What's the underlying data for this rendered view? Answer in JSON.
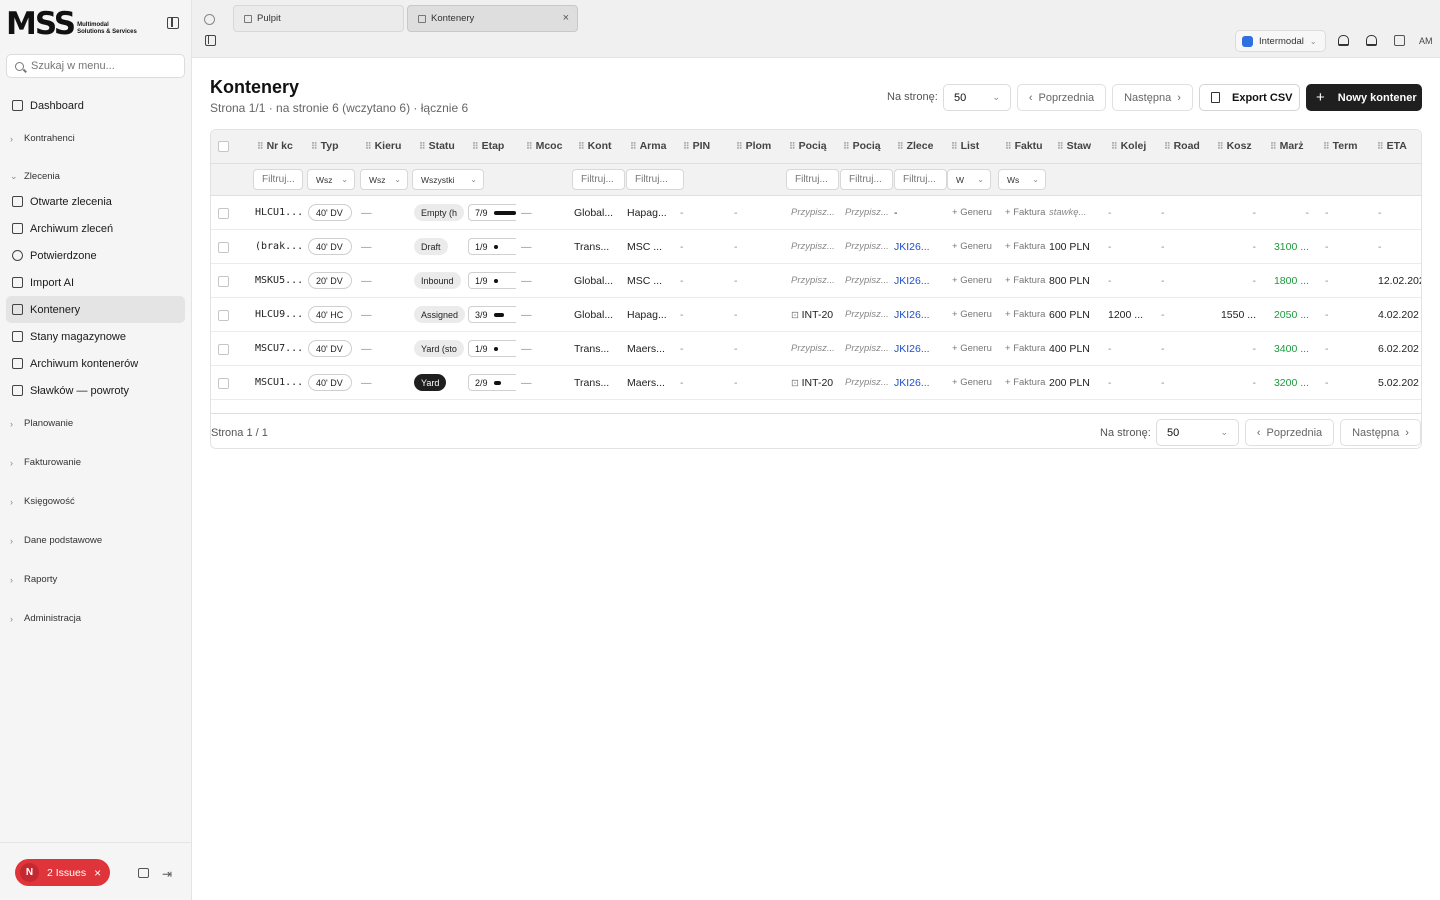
{
  "sidebar": {
    "logo_text": "MSS",
    "logo_sub1": "Multimodal",
    "logo_sub2": "Solutions & Services",
    "search_placeholder": "Szukaj w menu...",
    "items": [
      {
        "label": "Dashboard",
        "type": "item",
        "icon": "grid-icon"
      },
      {
        "label": "Kontrahenci",
        "type": "group"
      },
      {
        "label": "Zlecenia",
        "type": "group-open"
      },
      {
        "label": "Otwarte zlecenia",
        "type": "item",
        "icon": "file-icon"
      },
      {
        "label": "Archiwum zleceń",
        "type": "item",
        "icon": "archive-icon"
      },
      {
        "label": "Potwierdzone",
        "type": "item",
        "icon": "check-circle-icon"
      },
      {
        "label": "Import AI",
        "type": "item",
        "icon": "file-ai-icon"
      },
      {
        "label": "Kontenery",
        "type": "item",
        "icon": "box-icon",
        "active": true
      },
      {
        "label": "Stany magazynowe",
        "type": "item",
        "icon": "database-icon"
      },
      {
        "label": "Archiwum kontenerów",
        "type": "item",
        "icon": "archive-icon"
      },
      {
        "label": "Sławków — powroty",
        "type": "item",
        "icon": "archive-icon"
      },
      {
        "label": "Planowanie",
        "type": "group"
      },
      {
        "label": "Fakturowanie",
        "type": "group"
      },
      {
        "label": "Księgowość",
        "type": "group"
      },
      {
        "label": "Dane podstawowe",
        "type": "group"
      },
      {
        "label": "Raporty",
        "type": "group"
      },
      {
        "label": "Administracja",
        "type": "group"
      }
    ],
    "issues_badge": "N",
    "issues_label": "2 Issues"
  },
  "topbar": {
    "tabs": [
      {
        "label": "Pulpit"
      },
      {
        "label": "Kontenery",
        "active": true
      }
    ],
    "workspace": "Intermodal",
    "user_initials": "AM"
  },
  "page": {
    "title": "Kontenery",
    "subtitle": "Strona 1/1 · na stronie 6 (wczytano 6) · łącznie 6",
    "per_page_label": "Na stronę:",
    "per_page_value": "50",
    "prev_label": "Poprzednia",
    "next_label": "Następna",
    "export_label": "Export CSV",
    "new_label": "Nowy kontener"
  },
  "table": {
    "columns": [
      "Nr kc",
      "Typ",
      "Kieru",
      "Statu",
      "Etap",
      "Mcoc",
      "Kont",
      "Arma",
      "PIN",
      "Plom",
      "Pocią",
      "Pocią",
      "Zlece",
      "List",
      "Faktu",
      "Staw",
      "Kolej",
      "Road",
      "Kosz",
      "Marż",
      "Term",
      "ETA"
    ],
    "filters": {
      "nr": "Filtruj...",
      "typ": "Wsz",
      "kier": "Wsz",
      "status": "Wszystki",
      "kont": "Filtruj...",
      "arma": "Filtruj...",
      "poc1": "Filtruj...",
      "poc2": "Filtruj...",
      "zlec": "Filtruj...",
      "list": "W",
      "fakt": "Ws"
    },
    "rows": [
      {
        "nr": "HLCU1...",
        "typ": "40' DV",
        "kier": "—",
        "status": "Empty (h",
        "status_dark": false,
        "etap": "7/9",
        "etap_frac": 0.78,
        "mcoc": "—",
        "kont": "Global...",
        "arma": "Hapag...",
        "pin": "-",
        "plom": "-",
        "poc1": "Przypisz...",
        "poc1_int": false,
        "poc2": "Przypisz...",
        "zlec": "-",
        "zlec_link": false,
        "list": "Generu",
        "fakt": "Faktura",
        "staw": "stawkę...",
        "staw_italic": true,
        "kolej": "-",
        "road": "-",
        "kosz": "-",
        "marza": "-",
        "marza_green": false,
        "term": "-",
        "eta": "-"
      },
      {
        "nr": "(brak...",
        "typ": "40' DV",
        "kier": "—",
        "status": "Draft",
        "status_dark": false,
        "etap": "1/9",
        "etap_frac": 0.11,
        "mcoc": "—",
        "kont": "Trans...",
        "arma": "MSC ...",
        "pin": "-",
        "plom": "-",
        "poc1": "Przypisz...",
        "poc1_int": false,
        "poc2": "Przypisz...",
        "zlec": "JKI26...",
        "zlec_link": true,
        "list": "Generu",
        "fakt": "Faktura",
        "staw": "100 PLN",
        "staw_italic": false,
        "kolej": "-",
        "road": "-",
        "kosz": "-",
        "marza": "3100 ...",
        "marza_green": true,
        "term": "-",
        "eta": "-"
      },
      {
        "nr": "MSKU5...",
        "typ": "20' DV",
        "kier": "—",
        "status": "Inbound",
        "status_dark": false,
        "etap": "1/9",
        "etap_frac": 0.11,
        "mcoc": "—",
        "kont": "Global...",
        "arma": "MSC ...",
        "pin": "-",
        "plom": "-",
        "poc1": "Przypisz...",
        "poc1_int": false,
        "poc2": "Przypisz...",
        "zlec": "JKI26...",
        "zlec_link": true,
        "list": "Generu",
        "fakt": "Faktura",
        "staw": "800 PLN",
        "staw_italic": false,
        "kolej": "-",
        "road": "-",
        "kosz": "-",
        "marza": "1800 ...",
        "marza_green": true,
        "term": "-",
        "eta": "12.02.202"
      },
      {
        "nr": "HLCU9...",
        "typ": "40' HC",
        "kier": "—",
        "status": "Assigned",
        "status_dark": false,
        "etap": "3/9",
        "etap_frac": 0.33,
        "mcoc": "—",
        "kont": "Global...",
        "arma": "Hapag...",
        "pin": "-",
        "plom": "-",
        "poc1": "INT-20",
        "poc1_int": true,
        "poc2": "Przypisz...",
        "zlec": "JKI26...",
        "zlec_link": true,
        "list": "Generu",
        "fakt": "Faktura",
        "staw": "600 PLN",
        "staw_italic": false,
        "kolej": "1200 ...",
        "road": "-",
        "kosz": "1550 ...",
        "marza": "2050 ...",
        "marza_green": true,
        "term": "-",
        "eta": "4.02.202"
      },
      {
        "nr": "MSCU7...",
        "typ": "40' DV",
        "kier": "—",
        "status": "Yard (sto",
        "status_dark": false,
        "etap": "1/9",
        "etap_frac": 0.11,
        "mcoc": "—",
        "kont": "Trans...",
        "arma": "Maers...",
        "pin": "-",
        "plom": "-",
        "poc1": "Przypisz...",
        "poc1_int": false,
        "poc2": "Przypisz...",
        "zlec": "JKI26...",
        "zlec_link": true,
        "list": "Generu",
        "fakt": "Faktura",
        "staw": "400 PLN",
        "staw_italic": false,
        "kolej": "-",
        "road": "-",
        "kosz": "-",
        "marza": "3400 ...",
        "marza_green": true,
        "term": "-",
        "eta": "6.02.202"
      },
      {
        "nr": "MSCU1...",
        "typ": "40' DV",
        "kier": "—",
        "status": "Yard",
        "status_dark": true,
        "etap": "2/9",
        "etap_frac": 0.22,
        "mcoc": "—",
        "kont": "Trans...",
        "arma": "Maers...",
        "pin": "-",
        "plom": "-",
        "poc1": "INT-20",
        "poc1_int": true,
        "poc2": "Przypisz...",
        "zlec": "JKI26...",
        "zlec_link": true,
        "list": "Generu",
        "fakt": "Faktura",
        "staw": "200 PLN",
        "staw_italic": false,
        "kolej": "-",
        "road": "-",
        "kosz": "-",
        "marza": "3200 ...",
        "marza_green": true,
        "term": "-",
        "eta": "5.02.202"
      }
    ],
    "footer_info": "Strona 1 / 1"
  }
}
